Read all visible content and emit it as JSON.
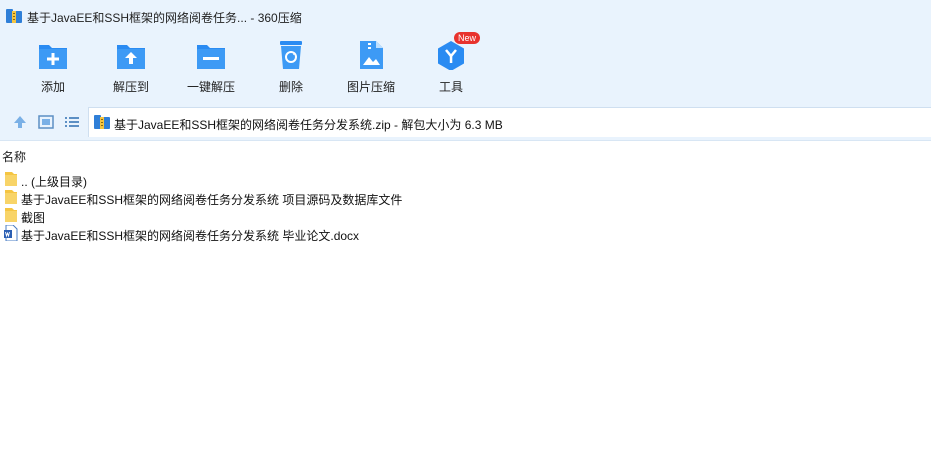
{
  "window": {
    "title": "基于JavaEE和SSH框架的网络阅卷任务... - 360压缩"
  },
  "toolbar": {
    "items": [
      {
        "label": "添加",
        "icon": "add-icon"
      },
      {
        "label": "解压到",
        "icon": "extract-to-icon"
      },
      {
        "label": "一键解压",
        "icon": "one-click-extract-icon"
      },
      {
        "label": "删除",
        "icon": "delete-icon"
      },
      {
        "label": "图片压缩",
        "icon": "image-compress-icon"
      },
      {
        "label": "工具",
        "icon": "tools-icon",
        "badge": "New"
      }
    ]
  },
  "nav": {
    "up": "up-arrow-icon",
    "view_thumbnails": "thumbnail-view-icon",
    "view_list": "list-view-icon"
  },
  "address": {
    "path": "基于JavaEE和SSH框架的网络阅卷任务分发系统.zip - 解包大小为 6.3 MB"
  },
  "columns": {
    "name": "名称"
  },
  "files": [
    {
      "name": ".. (上级目录)",
      "type": "folder"
    },
    {
      "name": "基于JavaEE和SSH框架的网络阅卷任务分发系统 项目源码及数据库文件",
      "type": "folder"
    },
    {
      "name": "截图",
      "type": "folder"
    },
    {
      "name": "基于JavaEE和SSH框架的网络阅卷任务分发系统 毕业论文.docx",
      "type": "docx"
    }
  ],
  "colors": {
    "toolbar_bg": "#e9f3fd",
    "icon_blue": "#2a8bf2",
    "folder_yellow": "#f5c542",
    "badge_red": "#e8322d"
  }
}
